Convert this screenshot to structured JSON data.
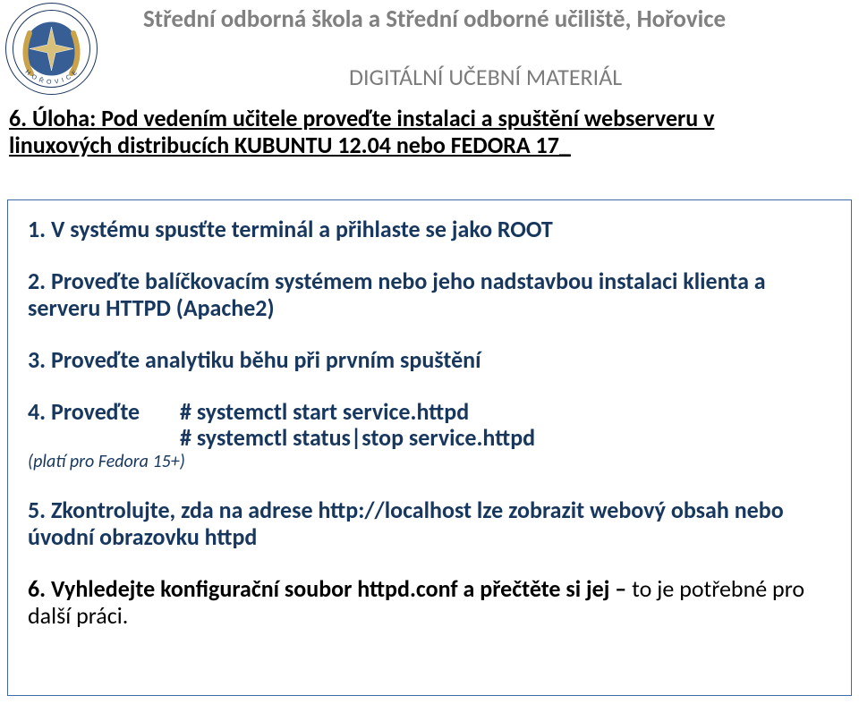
{
  "header": {
    "school": "Střední odborná škola a Střední odborné učiliště, Hořovice",
    "doc_title": "DIGITÁLNÍ UČEBNÍ MATERIÁL",
    "logo_arc": "H O Ř O V I C E"
  },
  "task": {
    "prefix": "6. Úloha:",
    "line1_rest": "  Pod vedením učitele proveďte instalaci a spuštění webserveru v ",
    "line2": "linuxových distribucích KUBUNTU 12.04  nebo FEDORA 17_"
  },
  "steps": {
    "s1": "1. V systému spusťte terminál a přihlaste se jako ROOT",
    "s2": "2. Proveďte balíčkovacím systémem nebo jeho nadstavbou instalaci klienta a serveru HTTPD (Apache2)",
    "s3": "3. Proveďte analytiku běhu při prvním spuštění",
    "s4_label": "4. Proveďte",
    "s4_cmd1": "# systemctl start service.httpd",
    "s4_cmd2": "# systemctl status|stop service.httpd",
    "s4_note": "(platí pro Fedora 15+)",
    "s5": "5. Zkontrolujte, zda na adrese http://localhost  lze zobrazit webový obsah nebo úvodní obrazovku httpd",
    "s6_bold": "6. Vyhledejte konfigurační soubor httpd.conf a přečtěte si jej – ",
    "s6_rest": "to je potřebné pro další práci."
  }
}
